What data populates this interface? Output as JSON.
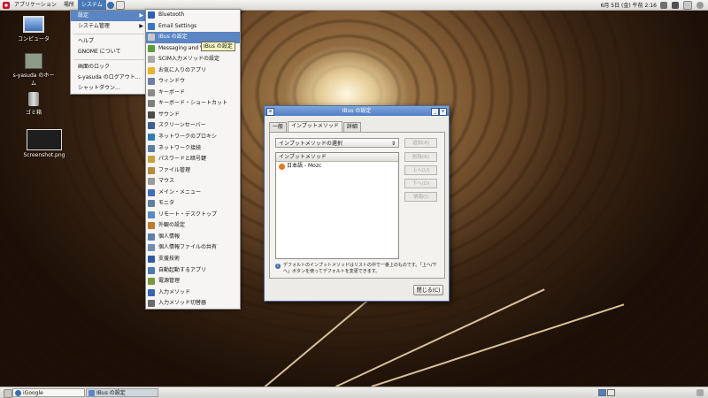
{
  "top_panel": {
    "menus": [
      "アプリケーション",
      "場所",
      "システム"
    ],
    "datetime": "6月  5日 (金) 午前 2:16"
  },
  "desktop_icons": [
    {
      "label": "コンピュータ"
    },
    {
      "label": "s-yasuda のホーム"
    },
    {
      "label": "ゴミ箱"
    },
    {
      "label": "Screenshot.png"
    }
  ],
  "system_menu": {
    "items": [
      "設定",
      "システム管理",
      "ヘルプ",
      "GNOME について",
      "画面のロック",
      "s-yasuda のログアウト...",
      "シャットダウン..."
    ]
  },
  "prefs_menu": {
    "items": [
      "Bluetooth",
      "Email Settings",
      "IBus の設定",
      "Messaging and VoIP",
      "SCIM入力メソッドの設定",
      "お気に入りのアプリ",
      "ウィンドウ",
      "キーボード",
      "キーボード・ショートカット",
      "サウンド",
      "スクリーンセーバー",
      "ネットワークのプロキシ",
      "ネットワーク接続",
      "パスワードと暗号鍵",
      "ファイル管理",
      "マウス",
      "メイン・メニュー",
      "モニタ",
      "リモート・デスクトップ",
      "外観の設定",
      "個人情報",
      "個人情報ファイルの共有",
      "支援技術",
      "自動起動するアプリ",
      "電源管理",
      "入力メソッド",
      "入力メソッド切替器"
    ],
    "icon_colors": [
      "#2f5fb4",
      "#3b73c4",
      "#c9c9c9",
      "#5a9d3a",
      "#a9a9a9",
      "#e7b52b",
      "#6a7fa8",
      "#8a8a8a",
      "#7e7e7e",
      "#4b4b4b",
      "#3e5f93",
      "#2e7bb8",
      "#5b7fa3",
      "#c7a23b",
      "#b28b3e",
      "#9a9a9a",
      "#3f6fb8",
      "#5f7f9f",
      "#5a8bc2",
      "#c07b2e",
      "#5d7fa8",
      "#6e8fb3",
      "#2e5aa8",
      "#4b7bb0",
      "#7a9a3a",
      "#3565b5",
      "#6a6a6a"
    ]
  },
  "tooltip": "IBus の設定",
  "dialog": {
    "title": "IBus の設定",
    "tabs": [
      "一般",
      "インプットメソッド",
      "詳細"
    ],
    "select_value": "インプットメソッドの選択",
    "side_buttons": [
      "追加(A)",
      "削除(R)",
      "上へ(U)",
      "下へ(D)",
      "情報(I)"
    ],
    "list_header": "インプットメソッド",
    "list_items": [
      {
        "name": "日本語  -  Mozc"
      }
    ],
    "info_text": "デフォルトのインプットメソッドはリストの中で一番上のものです。「上へ/下へ」ボタンを使ってデフォルトを変更できます。",
    "close_label": "閉じる(C)"
  },
  "bottom_panel": {
    "tasks": [
      "iGoogle",
      "IBus の設定"
    ]
  },
  "colors": {
    "selection": "#5b86c3",
    "titlebar": "#4f7fc4"
  }
}
